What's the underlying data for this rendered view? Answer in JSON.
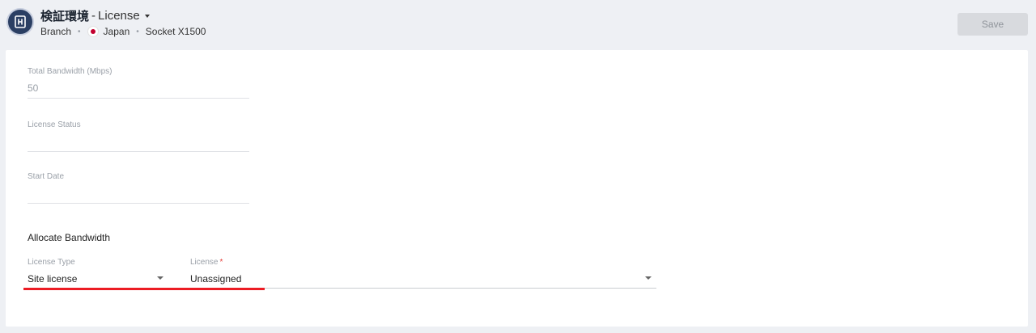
{
  "header": {
    "site_name": "検証環境",
    "separator": "-",
    "page": "License",
    "meta": {
      "type": "Branch",
      "country": "Japan",
      "socket": "Socket X1500"
    },
    "save_label": "Save"
  },
  "fields": {
    "total_bandwidth": {
      "label": "Total Bandwidth (Mbps)",
      "value": "50"
    },
    "license_status": {
      "label": "License Status",
      "value": ""
    },
    "start_date": {
      "label": "Start Date",
      "value": ""
    }
  },
  "allocate": {
    "title": "Allocate Bandwidth",
    "license_type": {
      "label": "License Type",
      "value": "Site license"
    },
    "license": {
      "label": "License",
      "required_mark": "*",
      "value": "Unassigned"
    }
  },
  "colors": {
    "brand": "#2b3f63",
    "required": "#e53935",
    "highlight_underline": "#ec1c24",
    "japan_flag": "#c3002f"
  },
  "icons": {
    "site": "building-icon",
    "title_dropdown": "caret-down-icon",
    "select_dropdown": "caret-down-icon"
  }
}
